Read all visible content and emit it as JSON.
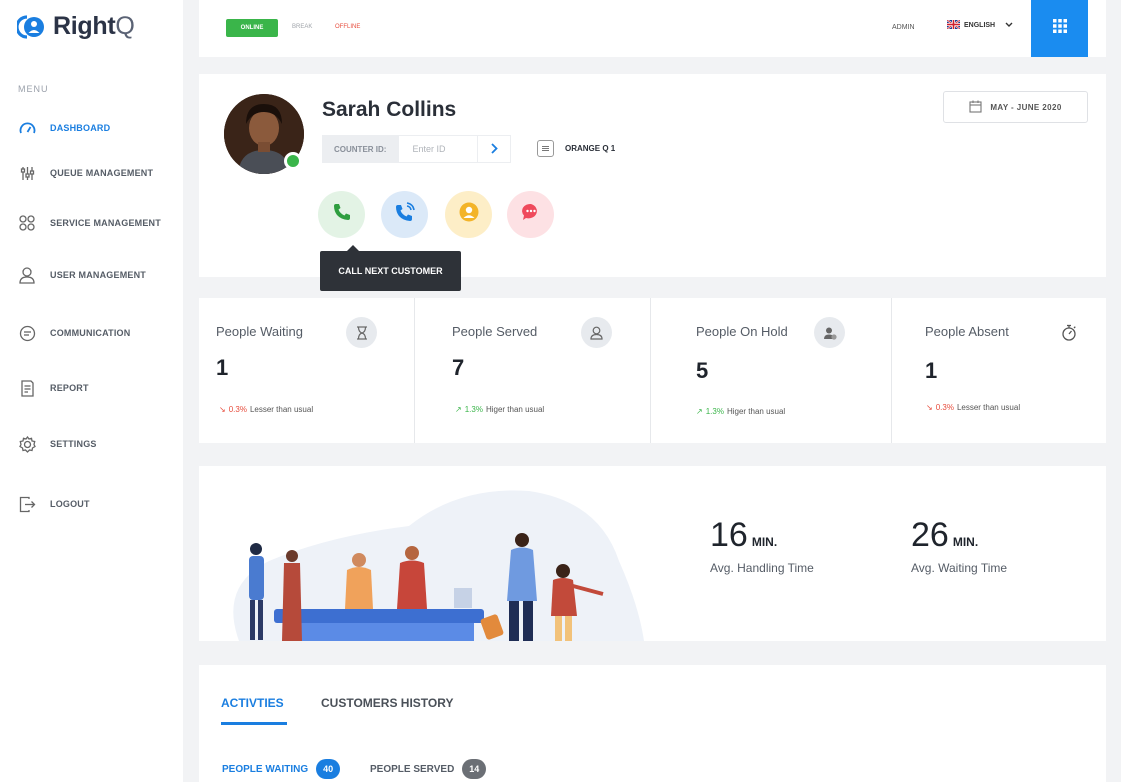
{
  "brand": {
    "name": "Right",
    "name_suffix": "Q"
  },
  "sidebar": {
    "menu_label": "MENU",
    "items": [
      {
        "label": "DASHBOARD",
        "icon": "gauge-icon",
        "active": true
      },
      {
        "label": "QUEUE MANAGEMENT",
        "icon": "sliders-icon"
      },
      {
        "label": "SERVICE MANAGEMENT",
        "icon": "grid-circles-icon"
      },
      {
        "label": "USER MANAGEMENT",
        "icon": "user-icon"
      },
      {
        "label": "COMMUNICATION",
        "icon": "chat-icon"
      },
      {
        "label": "REPORT",
        "icon": "report-icon"
      },
      {
        "label": "SETTINGS",
        "icon": "gear-icon"
      },
      {
        "label": "LOGOUT",
        "icon": "logout-icon"
      }
    ]
  },
  "topbar": {
    "status_online": "ONLINE",
    "status_break": "BREAK",
    "status_offline": "OFFLINE",
    "admin": "ADMIN",
    "language": "ENGLISH",
    "accent": "#1a8cf0"
  },
  "profile": {
    "name": "Sarah Collins",
    "counter_label": "COUNTER ID:",
    "counter_placeholder": "Enter ID",
    "queue": "ORANGE Q 1",
    "date_range": "MAY - JUNE 2020",
    "tooltip": "CALL NEXT CUSTOMER",
    "status_color": "#3ab54a"
  },
  "stats": [
    {
      "title": "People Waiting",
      "value": "1",
      "trend_pct": "0.3%",
      "trend_text": "Lesser than usual",
      "direction": "down",
      "icon": "hourglass-icon"
    },
    {
      "title": "People Served",
      "value": "7",
      "trend_pct": "1.3%",
      "trend_text": "Higer than usual",
      "direction": "up",
      "icon": "user-icon"
    },
    {
      "title": "People On Hold",
      "value": "5",
      "trend_pct": "1.3%",
      "trend_text": "Higer than usual",
      "direction": "up",
      "icon": "user-hold-icon"
    },
    {
      "title": "People Absent",
      "value": "1",
      "trend_pct": "0.3%",
      "trend_text": "Lesser than usual",
      "direction": "down",
      "icon": "stopwatch-icon"
    }
  ],
  "metrics": [
    {
      "value": "16",
      "unit": "MIN.",
      "label": "Avg. Handling Time"
    },
    {
      "value": "26",
      "unit": "MIN.",
      "label": "Avg. Waiting Time"
    }
  ],
  "activities": {
    "tabs": [
      "ACTIVTIES",
      "CUSTOMERS HISTORY"
    ],
    "pills": [
      {
        "label": "PEOPLE WAITING",
        "count": "40",
        "color": "#1a7ee0"
      },
      {
        "label": "PEOPLE SERVED",
        "count": "14",
        "color": "#6b6f75"
      }
    ]
  }
}
